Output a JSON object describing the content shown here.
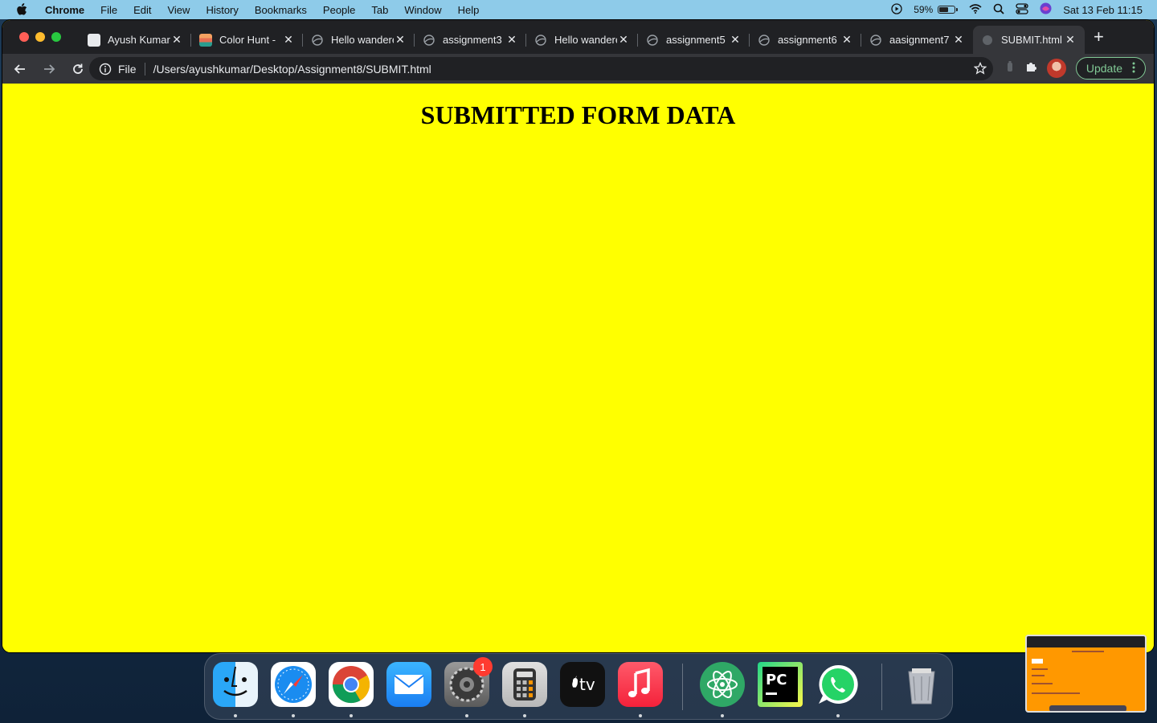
{
  "menubar": {
    "app_name": "Chrome",
    "items": [
      "File",
      "Edit",
      "View",
      "History",
      "Bookmarks",
      "People",
      "Tab",
      "Window",
      "Help"
    ],
    "battery_percent": "59%",
    "battery_level": 0.59,
    "datetime": "Sat 13 Feb  11:15"
  },
  "tabs": [
    {
      "title": "Ayush Kumar",
      "icon": "profile-favicon"
    },
    {
      "title": "Color Hunt - ",
      "icon": "colorhunt-favicon"
    },
    {
      "title": "Hello wanderer",
      "icon": "globe-icon"
    },
    {
      "title": "assignment3",
      "icon": "globe-icon"
    },
    {
      "title": "Hello wanderer",
      "icon": "globe-icon"
    },
    {
      "title": "assignment5",
      "icon": "globe-icon"
    },
    {
      "title": "assignment6",
      "icon": "globe-icon"
    },
    {
      "title": "aasignment7",
      "icon": "globe-icon"
    },
    {
      "title": "SUBMIT.html",
      "icon": "globe-icon",
      "active": true
    }
  ],
  "toolbar": {
    "scheme_label": "File",
    "url": "/Users/ayushkumar/Desktop/Assignment8/SUBMIT.html",
    "update_label": "Update"
  },
  "page": {
    "heading": "SUBMITTED FORM DATA",
    "background": "#ffff00"
  },
  "dock": {
    "apps": [
      "Finder",
      "Safari",
      "Google Chrome",
      "Mail",
      "System Preferences",
      "Calculator",
      "TV",
      "Music",
      "Atom",
      "PyCharm",
      "WhatsApp",
      "Trash"
    ],
    "settings_badge": "1"
  },
  "colors": {
    "menubar": "#8ecbe9",
    "tabstrip": "#202124",
    "toolbar": "#35363a",
    "update_accent": "#81c995"
  }
}
